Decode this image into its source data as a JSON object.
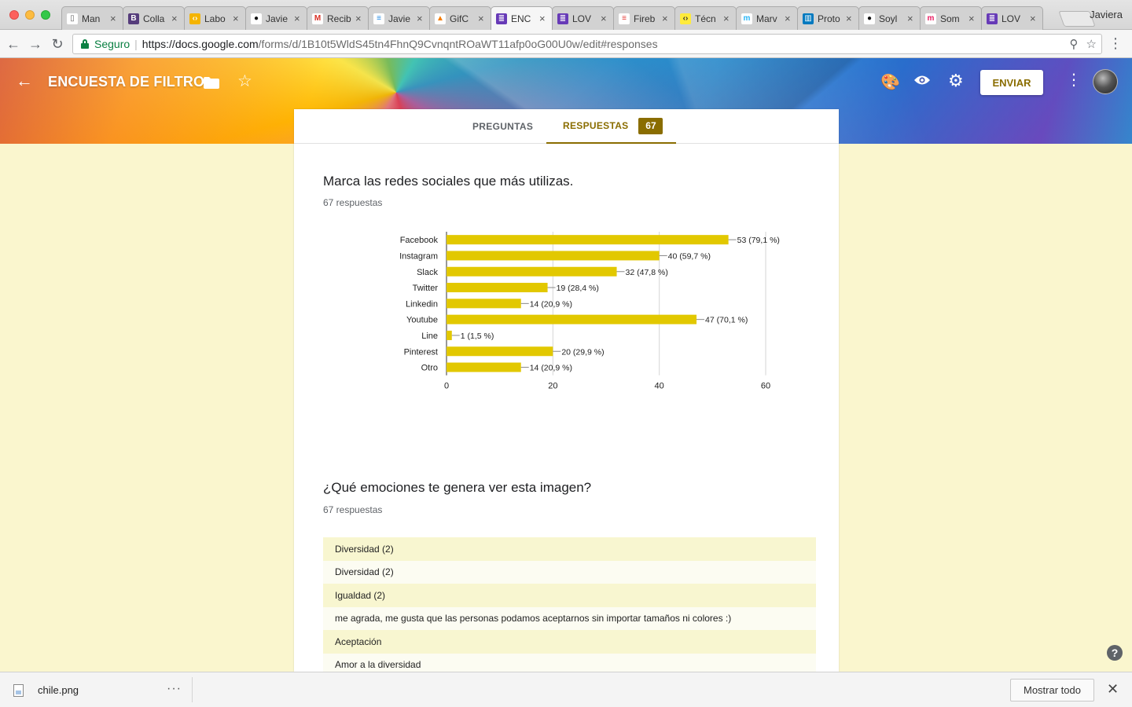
{
  "browser": {
    "profile_name": "Javiera",
    "tabs": [
      {
        "label": "Man",
        "fav_color": "#ffffff",
        "fav_glyph": "▯",
        "fav_fg": "#666"
      },
      {
        "label": "Colla",
        "fav_color": "#563d7c",
        "fav_glyph": "B",
        "fav_fg": "#fff"
      },
      {
        "label": "Labo",
        "fav_color": "#f4b400",
        "fav_glyph": "‹›",
        "fav_fg": "#fff"
      },
      {
        "label": "Javie",
        "fav_color": "#ffffff",
        "fav_glyph": "●",
        "fav_fg": "#111"
      },
      {
        "label": "Recib",
        "fav_color": "#ffffff",
        "fav_glyph": "M",
        "fav_fg": "#d93025"
      },
      {
        "label": "Javie",
        "fav_color": "#ffffff",
        "fav_glyph": "≡",
        "fav_fg": "#1e88e5"
      },
      {
        "label": "GifC",
        "fav_color": "#ffffff",
        "fav_glyph": "▲",
        "fav_fg": "#f57c00"
      },
      {
        "label": "ENC",
        "fav_color": "#673ab7",
        "fav_glyph": "≣",
        "fav_fg": "#fff"
      },
      {
        "label": "LOV",
        "fav_color": "#673ab7",
        "fav_glyph": "≣",
        "fav_fg": "#fff"
      },
      {
        "label": "Fireb",
        "fav_color": "#ffffff",
        "fav_glyph": "≡",
        "fav_fg": "#e53935"
      },
      {
        "label": "Técn",
        "fav_color": "#ffeb3b",
        "fav_glyph": "‹›",
        "fav_fg": "#333"
      },
      {
        "label": "Marv",
        "fav_color": "#ffffff",
        "fav_glyph": "m",
        "fav_fg": "#29b6f6"
      },
      {
        "label": "Proto",
        "fav_color": "#0079bf",
        "fav_glyph": "▥",
        "fav_fg": "#fff"
      },
      {
        "label": "Soyl",
        "fav_color": "#ffffff",
        "fav_glyph": "●",
        "fav_fg": "#111"
      },
      {
        "label": "Som",
        "fav_color": "#ffffff",
        "fav_glyph": "m",
        "fav_fg": "#e91e63"
      },
      {
        "label": "LOV",
        "fav_color": "#673ab7",
        "fav_glyph": "≣",
        "fav_fg": "#fff"
      }
    ],
    "active_tab_index": 7,
    "secure_label": "Seguro",
    "url_host": "https://docs.google.com",
    "url_path": "/forms/d/1B10t5WldS45tn4FhnQ9CvnqntROaWT11afp0oG00U0w/edit#responses"
  },
  "header": {
    "title": "ENCUESTA DE FILTRO",
    "send_label": "ENVIAR"
  },
  "card_tabs": {
    "questions_label": "PREGUNTAS",
    "responses_label": "RESPUESTAS",
    "responses_count": "67"
  },
  "questions": [
    {
      "title": "Marca las redes sociales que más utilizas.",
      "count_label": "67 respuestas"
    },
    {
      "title": "¿Qué emociones te genera ver esta imagen?",
      "count_label": "67 respuestas"
    }
  ],
  "chart_data": {
    "type": "bar",
    "orientation": "horizontal",
    "color": "#e2c800",
    "categories": [
      "Facebook",
      "Instagram",
      "Slack",
      "Twitter",
      "Linkedin",
      "Youtube",
      "Line",
      "Pinterest",
      "Otro"
    ],
    "values": [
      53,
      40,
      32,
      19,
      14,
      47,
      1,
      20,
      14
    ],
    "data_labels": [
      "53 (79,1 %)",
      "40 (59,7 %)",
      "32 (47,8 %)",
      "19 (28,4 %)",
      "14 (20,9 %)",
      "47 (70,1 %)",
      "1 (1,5 %)",
      "20 (29,9 %)",
      "14 (20,9 %)"
    ],
    "xlim": [
      0,
      60
    ],
    "xticks": [
      0,
      20,
      40,
      60
    ],
    "grid": true,
    "title": "",
    "xlabel": "",
    "ylabel": ""
  },
  "text_responses": [
    "Diversidad (2)",
    "Diversidad (2)",
    "Igualdad (2)",
    "me agrada, me gusta que las personas podamos aceptarnos sin importar tamaños ni colores :)",
    "Aceptación",
    "Amor a la diversidad"
  ],
  "download_bar": {
    "file_name": "chile.png",
    "show_all_label": "Mostrar todo"
  }
}
